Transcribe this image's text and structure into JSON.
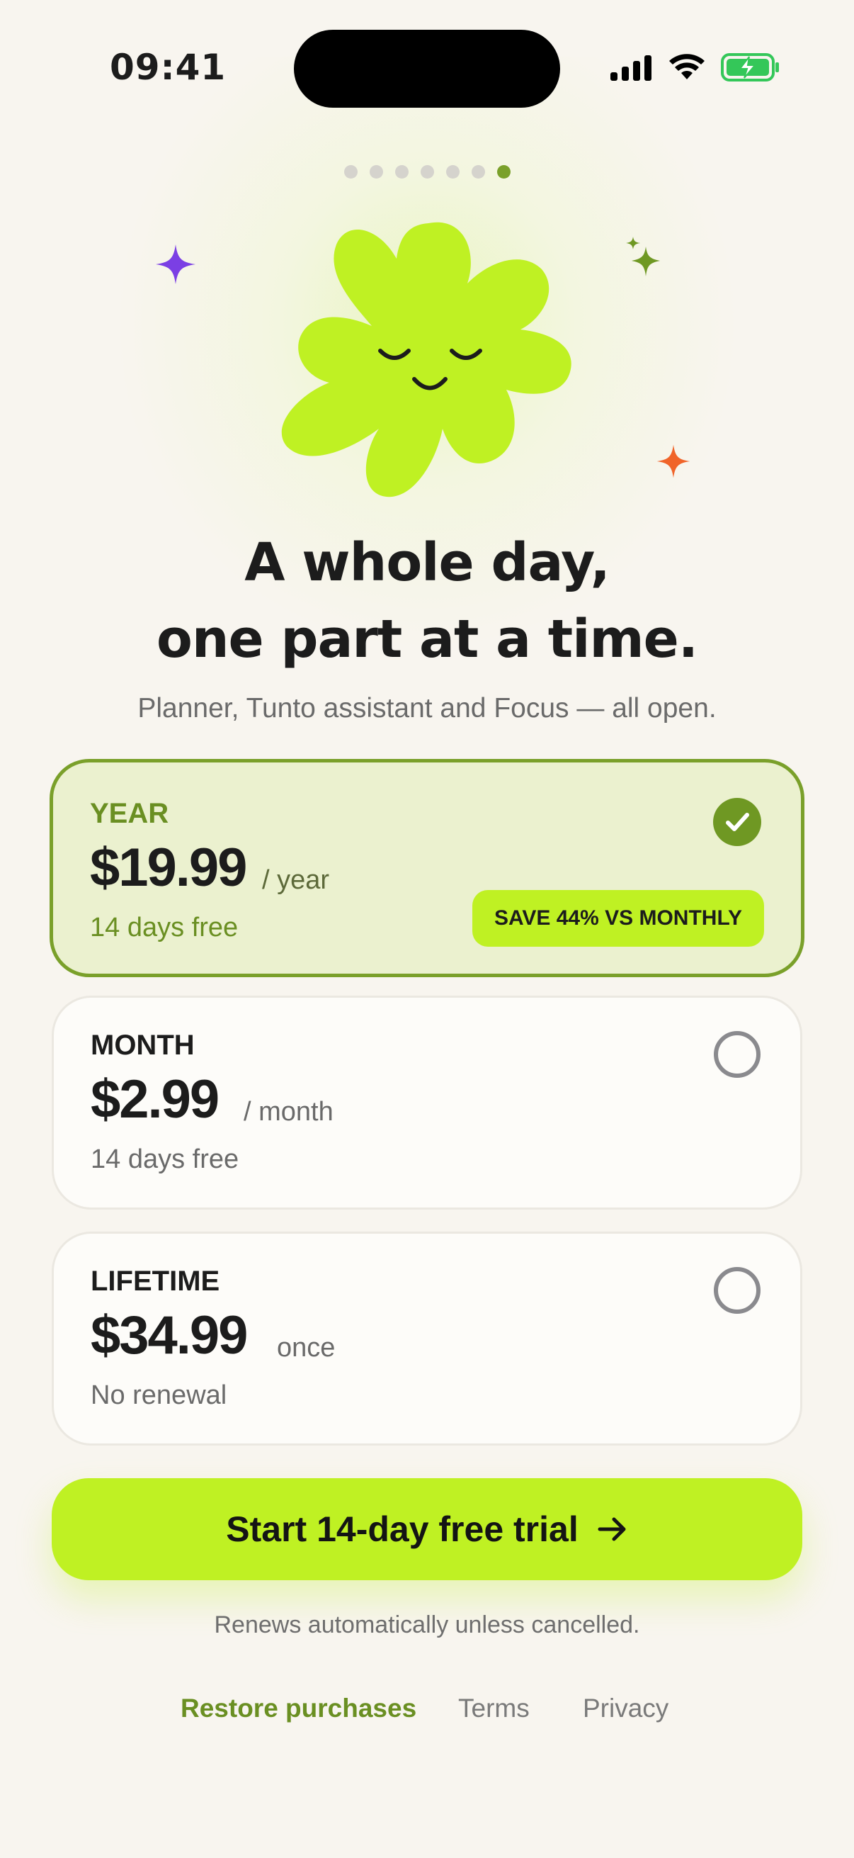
{
  "status_bar": {
    "time": "09:41",
    "icons": [
      "cellular-signal-icon",
      "wifi-icon",
      "battery-charging-icon"
    ]
  },
  "pager": {
    "total_pages": 7,
    "current_page": 7
  },
  "hero": {
    "mascot": "smiling-flower-mascot",
    "sparkles": [
      {
        "icon": "sparkle-icon",
        "color": "#7b3fe4"
      },
      {
        "icon": "sparkles-icon",
        "color": "#6f9823"
      },
      {
        "icon": "sparkle-icon",
        "color": "#f0642a"
      }
    ],
    "mascot_color": "#bff123"
  },
  "headline": {
    "line1": "A whole day,",
    "line2": "one part at a time."
  },
  "subheadline": "Planner, Tunto assistant and Focus — all open.",
  "plans": [
    {
      "name": "YEAR",
      "price": "$19.99",
      "unit": "/ year",
      "note": "14 days free",
      "badge": "SAVE 44% VS MONTHLY",
      "selected": true
    },
    {
      "name": "MONTH",
      "price": "$2.99",
      "unit": "/ month",
      "note": "14 days free",
      "selected": false
    },
    {
      "name": "LIFETIME",
      "price": "$34.99",
      "unit": "once",
      "note": "No renewal",
      "selected": false
    }
  ],
  "cta": {
    "label": "Start 14-day free trial",
    "icon": "arrow-right-icon"
  },
  "renew_note": "Renews automatically unless cancelled.",
  "footer": {
    "restore": "Restore purchases",
    "terms": "Terms",
    "privacy": "Privacy"
  },
  "colors": {
    "accent": "#bff123",
    "accent_dark": "#6f9823",
    "background": "#f8f5ef"
  }
}
